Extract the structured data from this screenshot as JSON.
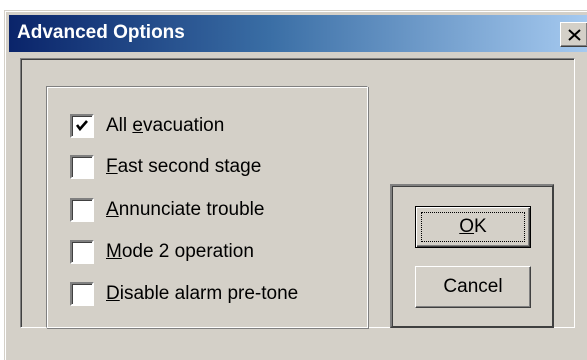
{
  "window": {
    "title": "Advanced Options"
  },
  "icons": {
    "close": "close-icon",
    "check": "checkmark-icon"
  },
  "colors": {
    "title_gradient_start": "#0a246a",
    "title_gradient_end": "#a6caf0",
    "face": "#d4d0c8"
  },
  "options": [
    {
      "label_pre": "All ",
      "mnemonic": "e",
      "label_post": "vacuation",
      "checked": true
    },
    {
      "label_pre": "",
      "mnemonic": "F",
      "label_post": "ast second stage",
      "checked": false
    },
    {
      "label_pre": "",
      "mnemonic": "A",
      "label_post": "nnunciate trouble",
      "checked": false
    },
    {
      "label_pre": "",
      "mnemonic": "M",
      "label_post": "ode 2 operation",
      "checked": false
    },
    {
      "label_pre": "",
      "mnemonic": "D",
      "label_post": "isable alarm pre-tone",
      "checked": false
    }
  ],
  "buttons": {
    "ok_label_mnemonic": "O",
    "ok_label_rest": "K",
    "cancel_label": "Cancel"
  }
}
